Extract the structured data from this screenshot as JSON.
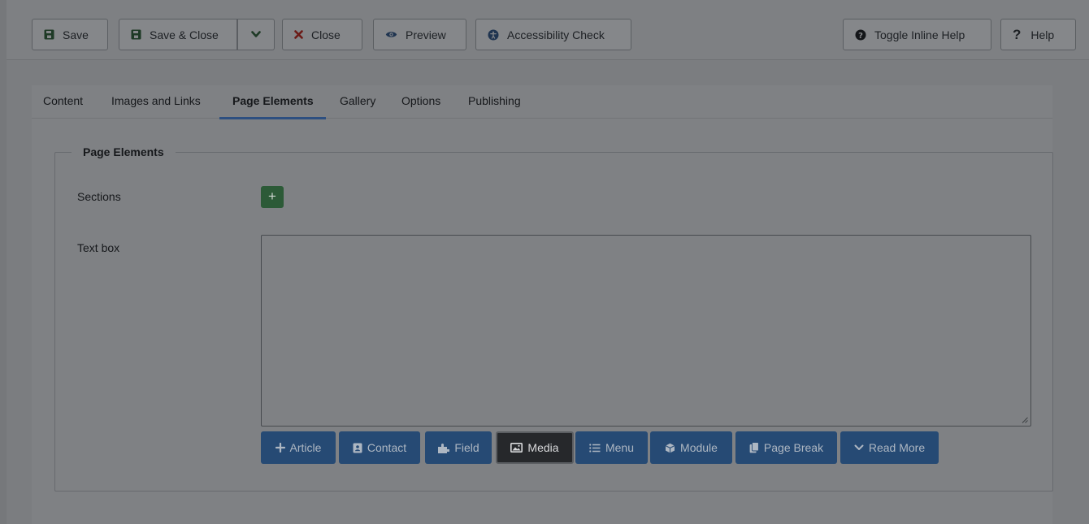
{
  "toolbar": {
    "save": "Save",
    "save_close": "Save & Close",
    "close": "Close",
    "preview": "Preview",
    "accessibility": "Accessibility Check",
    "toggle_help": "Toggle Inline Help",
    "help": "Help"
  },
  "tabs": [
    {
      "label": "Content"
    },
    {
      "label": "Images and Links"
    },
    {
      "label": "Page Elements"
    },
    {
      "label": "Gallery"
    },
    {
      "label": "Options"
    },
    {
      "label": "Publishing"
    }
  ],
  "fieldset": {
    "legend": "Page Elements",
    "sections_label": "Sections",
    "add_symbol": "+",
    "textbox_label": "Text box"
  },
  "editor_buttons": [
    {
      "label": "Article",
      "icon": "plus-icon"
    },
    {
      "label": "Contact",
      "icon": "address-card-icon"
    },
    {
      "label": "Field",
      "icon": "puzzle-icon"
    },
    {
      "label": "Media",
      "icon": "image-icon"
    },
    {
      "label": "Menu",
      "icon": "list-icon"
    },
    {
      "label": "Module",
      "icon": "cube-icon"
    },
    {
      "label": "Page Break",
      "icon": "copy-icon"
    },
    {
      "label": "Read More",
      "icon": "chevron-down-icon"
    }
  ],
  "colors": {
    "overlay_bg": "#7b7d80",
    "primary_button": "#264a74",
    "success_button": "#2c5a37",
    "active_tab_underline": "#2d4f80"
  }
}
